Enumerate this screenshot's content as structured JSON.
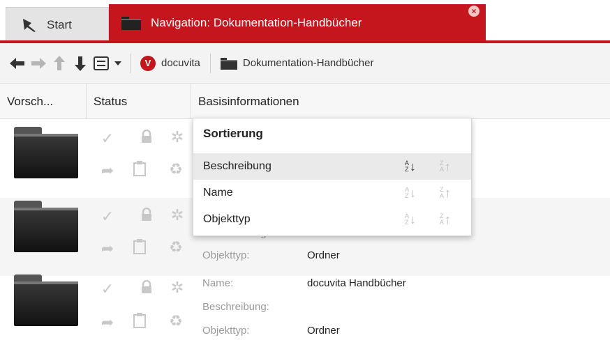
{
  "tabs": {
    "start_label": "Start",
    "active_label": "Navigation: Dokumentation-Handbücher",
    "close_symbol": "×"
  },
  "toolbar": {
    "icons": [
      "back-arrow-icon",
      "forward-arrow-icon",
      "up-arrow-icon",
      "down-arrow-icon",
      "list-view-icon",
      "caret-down-icon"
    ],
    "breadcrumb": [
      "docuvita",
      "Dokumentation-Handbücher"
    ]
  },
  "columns": [
    "Vorsch...",
    "Status",
    "Basisinformationen"
  ],
  "sort_menu": {
    "title": "Sortierung",
    "items": [
      {
        "label": "Beschreibung",
        "active_direction": "asc"
      },
      {
        "label": "Name",
        "active_direction": ""
      },
      {
        "label": "Objekttyp",
        "active_direction": ""
      }
    ]
  },
  "rows": [
    {
      "fields": []
    },
    {
      "fields": [
        {
          "label": "Beschreibung:",
          "value": ""
        },
        {
          "label": "Objekttyp:",
          "value": "Ordner"
        }
      ]
    },
    {
      "fields": [
        {
          "label": "Name:",
          "value": "docuvita Handbücher"
        },
        {
          "label": "Beschreibung:",
          "value": ""
        },
        {
          "label": "Objekttyp:",
          "value": "Ordner"
        }
      ]
    }
  ],
  "colors": {
    "accent": "#c4161c"
  }
}
